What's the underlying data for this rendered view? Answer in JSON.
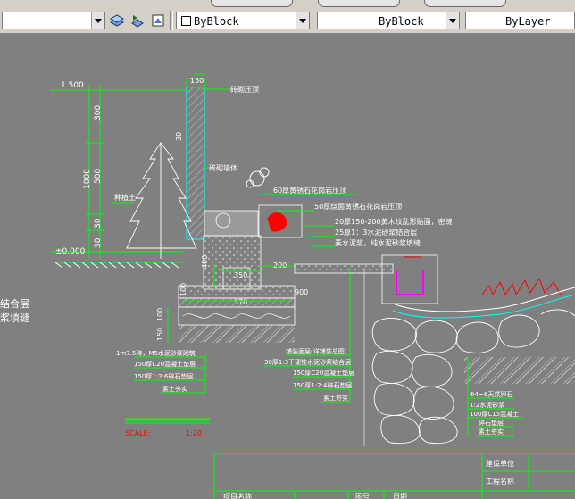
{
  "toolbar": {
    "layer_dropdown_value": "",
    "color_dropdown_value": "ByBlock",
    "linetype_dropdown_value": "ByBlock",
    "lineweight_dropdown_value": "ByLayer",
    "colors": {
      "toolbar_bg": "#d4d0c8",
      "canvas_bg": "#808080",
      "cad_green": "#00ff00",
      "cad_white": "#ffffff",
      "cad_red": "#ff0000",
      "cad_magenta": "#ff00ff",
      "cad_cyan": "#00ffff"
    }
  },
  "drawing": {
    "dims": {
      "d1500": "1.500",
      "d150_top": "150",
      "d300": "300",
      "d500": "500",
      "d1000": "1000",
      "d30a": "30",
      "d30b": "30",
      "d100": "100",
      "d0000": "±0.000",
      "d400": "400",
      "d350": "350",
      "d200": "200",
      "d100b": "100",
      "d900": "900",
      "d570": "570",
      "d100c": "100",
      "d150b": "150",
      "d100d": "100"
    },
    "left_labels": {
      "planting": "种植土",
      "cap": "砖砌压顶",
      "wall": "砖砌墙体"
    },
    "callouts": {
      "c1": "60厚黄锈石花岗岩压顶",
      "c2": "50厚烧面黄锈石花岗岩压顶",
      "c3": "20厚150-200黄木纹乱形贴面，密缝",
      "c4": "25厚1：3水泥砂浆结合层",
      "c5": "素水泥浆，纯水泥砂浆填缝"
    },
    "left_edge_text": {
      "t1": "结合层",
      "t2": "浆填缝"
    },
    "layers_left": {
      "l1": "1m7.5砖，M5水泥砂浆砌筑",
      "l2": "150厚C20混凝土垫层",
      "l3": "150厚1:2:6碎石垫层",
      "l4": "素土夯实"
    },
    "layers_mid": {
      "m1": "铺装面层(详铺装总图)",
      "m2": "30厚1:3干硬性水泥砂浆结合层",
      "m3": "150厚C20混凝土垫层",
      "m4": "150厚1:2:4碎石垫层",
      "m5": "素土夯实"
    },
    "layers_right": {
      "r1": "Φ4~6天然卵石",
      "r2": "1:2水泥砂浆",
      "r3": "100厚C15混凝土",
      "r4": "碎石垫层",
      "r5": "素土夯实"
    },
    "scale": {
      "label": "SCALE:",
      "value": "1:20"
    },
    "title_block": {
      "owner": "建设单位",
      "project": "工程名称",
      "a": "项目名称",
      "b": "图号",
      "c": "日期"
    }
  }
}
